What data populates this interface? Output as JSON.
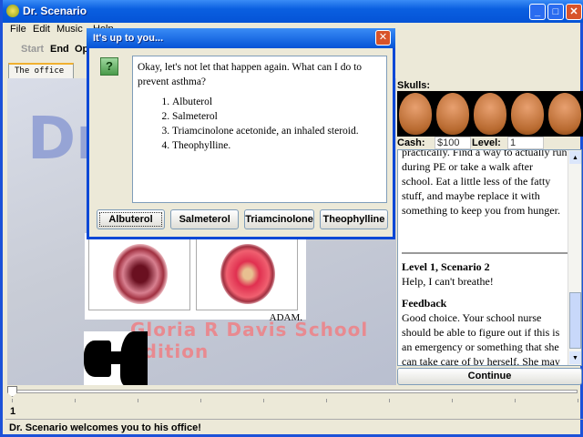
{
  "window": {
    "title": "Dr. Scenario",
    "minimize": "_",
    "maximize": "□",
    "close": "✕"
  },
  "menu": [
    "File",
    "Edit",
    "Music",
    "Help"
  ],
  "toolbar": [
    "Start",
    "End",
    "Open"
  ],
  "tab": "The office",
  "scene": {
    "logo": "Dr.",
    "edition": "Gloria R Davis School Edition",
    "credit": "ADAM."
  },
  "stats": {
    "skulls_label": "Skulls:",
    "skull_count": 5,
    "cash_label": "Cash:",
    "cash": "$100",
    "level_label": "Level:",
    "level": "1"
  },
  "log": {
    "partial_line": "practically. Find a way to actually run",
    "prev_text": "during PE or take a walk after school. Eat a little less of the fatty stuff, and maybe replace it with something to keep you from hunger.",
    "heading": "Level 1, Scenario 2",
    "subtitle": "Help, I can't breathe!",
    "feedback_heading": "Feedback",
    "feedback": "Good choice. Your school nurse should be able to figure out if this is an emergency or something that she can take care of by herself. She may have albuterol handy, too."
  },
  "continue_label": "Continue",
  "slider": {
    "value": "1"
  },
  "status": "Dr. Scenario welcomes you to his office!",
  "dialog": {
    "title": "It's up to you...",
    "icon": "question-icon",
    "question": "Okay, let's not let that happen again. What can I do to prevent asthma?",
    "options": [
      "Albuterol",
      "Salmeterol",
      "Triamcinolone acetonide, an inhaled steroid.",
      "Theophylline."
    ],
    "buttons": [
      "Albuterol",
      "Salmeterol",
      "Triamcinolone",
      "Theophylline"
    ]
  }
}
